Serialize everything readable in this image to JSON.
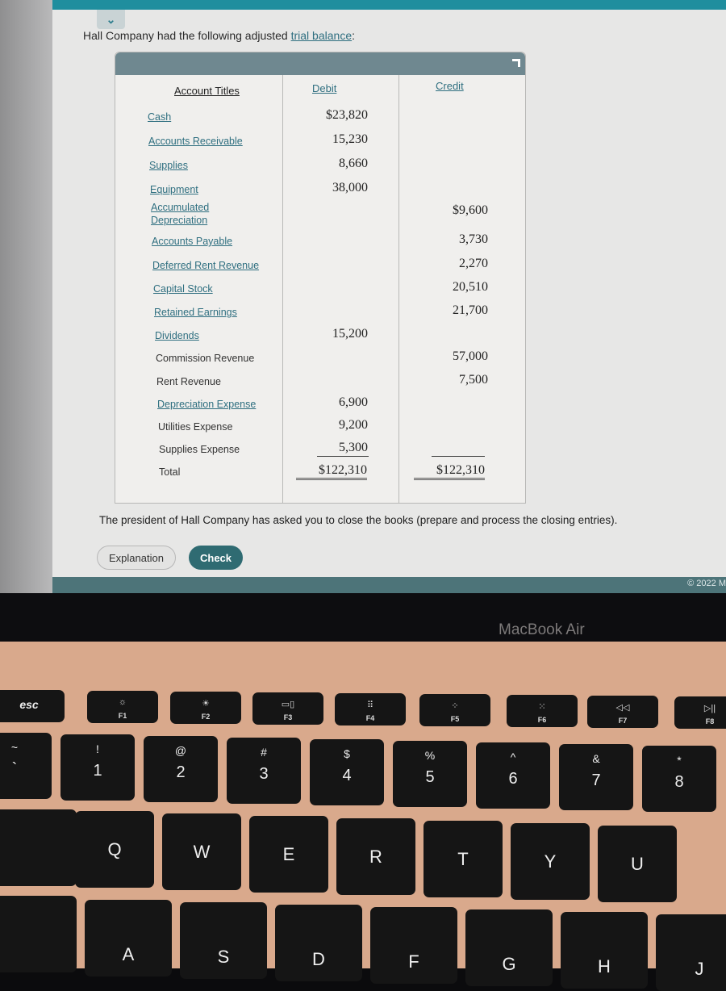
{
  "intro": {
    "text": "Hall Company had the following adjusted ",
    "link": "trial balance",
    "suffix": ":"
  },
  "table": {
    "headers": {
      "account": "Account Titles",
      "debit": "Debit",
      "credit": "Credit"
    },
    "rows": [
      {
        "account": "Cash",
        "debit": "$23,820",
        "credit": ""
      },
      {
        "account": "Accounts Receivable",
        "debit": "15,230",
        "credit": ""
      },
      {
        "account": "Supplies",
        "debit": "8,660",
        "credit": ""
      },
      {
        "account": "Equipment",
        "debit": "38,000",
        "credit": ""
      },
      {
        "account": "Accumulated Depreciation",
        "debit": "",
        "credit": "$9,600"
      },
      {
        "account": "Accounts Payable",
        "debit": "",
        "credit": "3,730"
      },
      {
        "account": "Deferred Rent Revenue",
        "debit": "",
        "credit": "2,270"
      },
      {
        "account": "Capital Stock",
        "debit": "",
        "credit": "20,510"
      },
      {
        "account": "Retained Earnings",
        "debit": "",
        "credit": "21,700"
      },
      {
        "account": "Dividends",
        "debit": "15,200",
        "credit": ""
      },
      {
        "account": "Commission Revenue",
        "debit": "",
        "credit": "57,000"
      },
      {
        "account": "Rent Revenue",
        "debit": "",
        "credit": "7,500"
      },
      {
        "account": "Depreciation Expense",
        "debit": "6,900",
        "credit": ""
      },
      {
        "account": "Utilities Expense",
        "debit": "9,200",
        "credit": ""
      },
      {
        "account": "Supplies Expense",
        "debit": "5,300",
        "credit": ""
      }
    ],
    "total": {
      "label": "Total",
      "debit": "$122,310",
      "credit": "$122,310"
    }
  },
  "question": "The president of Hall Company has asked you to close the books (prepare and process the closing entries).",
  "buttons": {
    "explanation": "Explanation",
    "check": "Check"
  },
  "copyright": "© 2022 M",
  "laptop": {
    "brand": "MacBook Air",
    "fkeys": [
      {
        "label": "esc",
        "icon": ""
      },
      {
        "label": "F1",
        "icon": "☼"
      },
      {
        "label": "F2",
        "icon": "☀"
      },
      {
        "label": "F3",
        "icon": "▭▯"
      },
      {
        "label": "F4",
        "icon": "⠿"
      },
      {
        "label": "F5",
        "icon": "⁘"
      },
      {
        "label": "F6",
        "icon": "⁙"
      },
      {
        "label": "F7",
        "icon": "◁◁"
      },
      {
        "label": "F8",
        "icon": "▷||"
      }
    ],
    "numkeys": [
      {
        "sym": "~",
        "num": "`"
      },
      {
        "sym": "!",
        "num": "1"
      },
      {
        "sym": "@",
        "num": "2"
      },
      {
        "sym": "#",
        "num": "3"
      },
      {
        "sym": "$",
        "num": "4"
      },
      {
        "sym": "%",
        "num": "5"
      },
      {
        "sym": "^",
        "num": "6"
      },
      {
        "sym": "&",
        "num": "7"
      },
      {
        "sym": "*",
        "num": "8"
      }
    ],
    "qrow": [
      "Q",
      "W",
      "E",
      "R",
      "T",
      "Y",
      "U"
    ],
    "arow": [
      "A",
      "S",
      "D",
      "F",
      "G",
      "H",
      "J"
    ]
  }
}
